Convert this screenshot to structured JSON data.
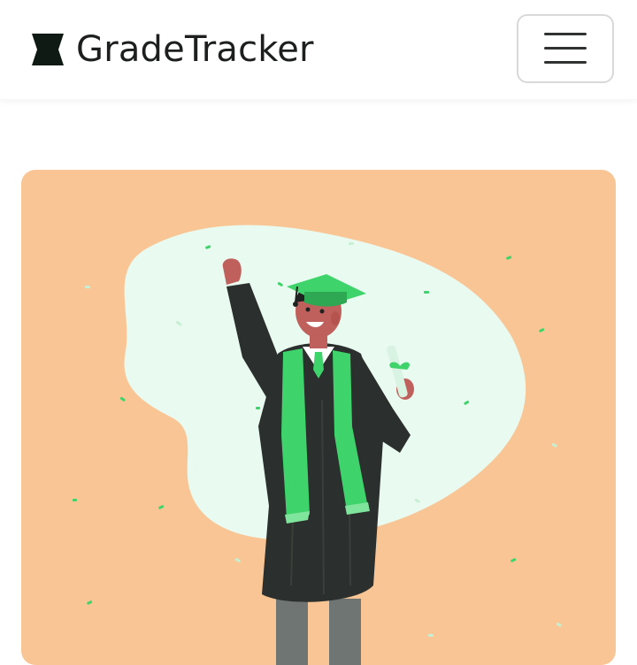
{
  "navbar": {
    "brand_name": "GradeTracker",
    "brand_icon": "bookmark-logo-icon",
    "toggle_icon": "hamburger-menu-icon"
  },
  "hero": {
    "illustration": "graduate-celebrating-illustration",
    "colors": {
      "background": "#fac594",
      "blob": "#e9faf0",
      "accent_green": "#3fd46b",
      "gown": "#2b2f2d"
    }
  }
}
